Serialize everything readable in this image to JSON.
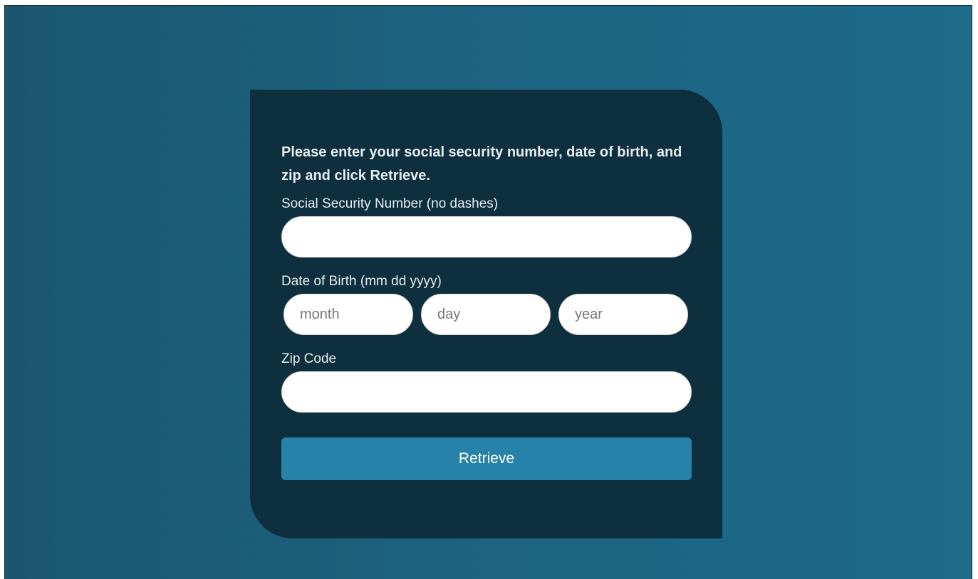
{
  "form": {
    "instructions": "Please enter your social security number, date of birth, and zip and click Retrieve.",
    "ssn": {
      "label": "Social Security Number (no dashes)",
      "value": ""
    },
    "dob": {
      "label": "Date of Birth (mm dd yyyy)",
      "month_placeholder": "month",
      "day_placeholder": "day",
      "year_placeholder": "year"
    },
    "zip": {
      "label": "Zip Code",
      "value": ""
    },
    "submit_label": "Retrieve"
  },
  "colors": {
    "background": "#1c6583",
    "card": "#0e2f3e",
    "button": "#2682a8",
    "text": "#e6eef2"
  }
}
